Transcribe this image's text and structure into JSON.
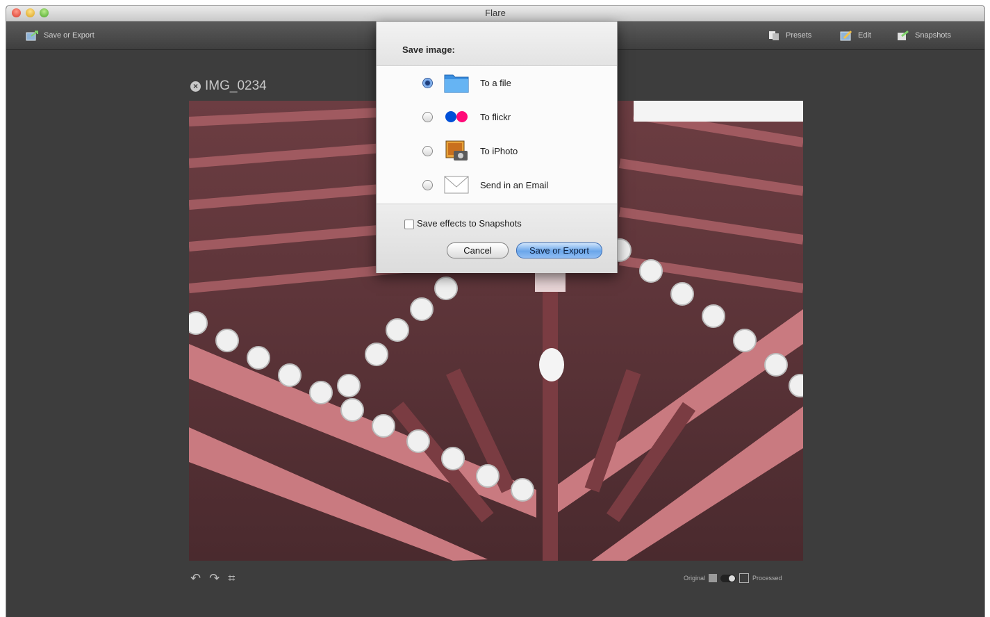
{
  "window": {
    "title": "Flare"
  },
  "toolbar": {
    "save_export_label": "Save or Export",
    "presets_label": "Presets",
    "edit_label": "Edit",
    "snapshots_label": "Snapshots"
  },
  "document": {
    "title": "IMG_0234"
  },
  "dialog": {
    "heading": "Save image:",
    "options": [
      {
        "label": "To a file",
        "selected": true,
        "icon": "folder-icon"
      },
      {
        "label": "To flickr",
        "selected": false,
        "icon": "flickr-icon"
      },
      {
        "label": "To iPhoto",
        "selected": false,
        "icon": "iphoto-icon"
      },
      {
        "label": "Send in an Email",
        "selected": false,
        "icon": "envelope-icon"
      }
    ],
    "checkbox_label": "Save effects to Snapshots",
    "checkbox_checked": false,
    "cancel_label": "Cancel",
    "primary_label": "Save or Export"
  },
  "compare": {
    "original_label": "Original",
    "processed_label": "Processed"
  },
  "colors": {
    "accent": "#6aa6ea",
    "toolbar_bg": "#4a4a4a",
    "canvas_bg": "#3d3d3d"
  }
}
